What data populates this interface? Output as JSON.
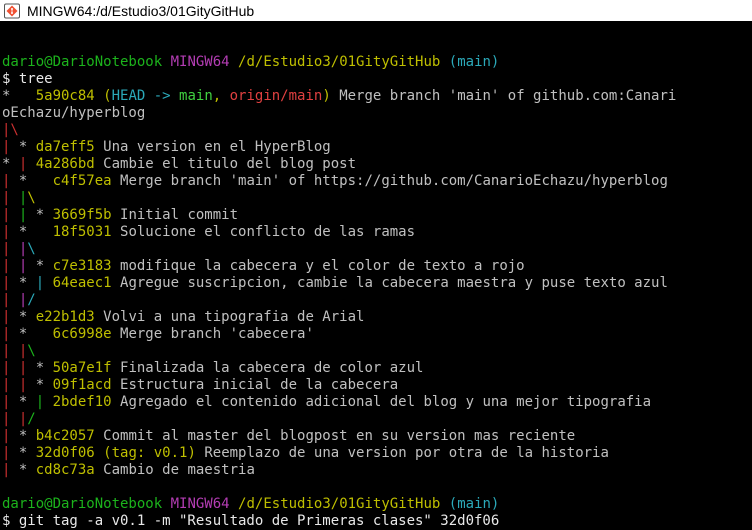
{
  "window": {
    "title": "MINGW64:/d/Estudio3/01GityGitHub"
  },
  "colors": {
    "user": "#1cb31c",
    "shell": "#b43db4",
    "path": "#bfbf00",
    "branch": "#2ba9b9",
    "graph_red": "#cc3030",
    "text": "#c0c0c0",
    "background": "#000000"
  },
  "lines": [
    [],
    [
      {
        "t": "dario@DarioNotebook",
        "c": "green"
      },
      {
        "t": " ",
        "c": "grey"
      },
      {
        "t": "MINGW64",
        "c": "magenta"
      },
      {
        "t": " ",
        "c": "grey"
      },
      {
        "t": "/d/Estudio3/01GityGitHub",
        "c": "yellow"
      },
      {
        "t": " ",
        "c": "grey"
      },
      {
        "t": "(main)",
        "c": "cyan"
      }
    ],
    [
      {
        "t": "$ tree",
        "c": "white"
      }
    ],
    [
      {
        "t": "*   ",
        "c": "grey"
      },
      {
        "t": "5a90c84 ",
        "c": "yellow"
      },
      {
        "t": "(",
        "c": "yellow"
      },
      {
        "t": "HEAD -> ",
        "c": "cyan"
      },
      {
        "t": "main",
        "c": "lime"
      },
      {
        "t": ", ",
        "c": "yellow"
      },
      {
        "t": "origin/main",
        "c": "red-bright"
      },
      {
        "t": ")",
        "c": "yellow"
      },
      {
        "t": " Merge branch 'main' of github.com:Canari",
        "c": "grey"
      }
    ],
    [
      {
        "t": "oEchazu/hyperblog",
        "c": "grey"
      }
    ],
    [
      {
        "t": "|\\",
        "c": "red"
      }
    ],
    [
      {
        "t": "| ",
        "c": "red"
      },
      {
        "t": "* ",
        "c": "grey"
      },
      {
        "t": "da7eff5",
        "c": "yellow"
      },
      {
        "t": " Una version en el HyperBlog",
        "c": "grey"
      }
    ],
    [
      {
        "t": "* ",
        "c": "grey"
      },
      {
        "t": "| ",
        "c": "red"
      },
      {
        "t": "4a286bd",
        "c": "yellow"
      },
      {
        "t": " Cambie el titulo del blog post",
        "c": "grey"
      }
    ],
    [
      {
        "t": "| ",
        "c": "red"
      },
      {
        "t": "*   ",
        "c": "grey"
      },
      {
        "t": "c4f57ea",
        "c": "yellow"
      },
      {
        "t": " Merge branch 'main' of https://github.com/CanarioEchazu/hyperblog",
        "c": "grey"
      }
    ],
    [
      {
        "t": "| ",
        "c": "red"
      },
      {
        "t": "|",
        "c": "green"
      },
      {
        "t": "\\",
        "c": "yellow"
      }
    ],
    [
      {
        "t": "| ",
        "c": "red"
      },
      {
        "t": "| ",
        "c": "green"
      },
      {
        "t": "* ",
        "c": "grey"
      },
      {
        "t": "3669f5b",
        "c": "yellow"
      },
      {
        "t": " Initial commit",
        "c": "grey"
      }
    ],
    [
      {
        "t": "| ",
        "c": "red"
      },
      {
        "t": "*   ",
        "c": "grey"
      },
      {
        "t": "18f5031",
        "c": "yellow"
      },
      {
        "t": " Solucione el conflicto de las ramas",
        "c": "grey"
      }
    ],
    [
      {
        "t": "| ",
        "c": "red"
      },
      {
        "t": "|",
        "c": "magenta"
      },
      {
        "t": "\\",
        "c": "cyan"
      }
    ],
    [
      {
        "t": "| ",
        "c": "red"
      },
      {
        "t": "| ",
        "c": "magenta"
      },
      {
        "t": "* ",
        "c": "grey"
      },
      {
        "t": "c7e3183",
        "c": "yellow"
      },
      {
        "t": " modifique la cabecera y el color de texto a rojo",
        "c": "grey"
      }
    ],
    [
      {
        "t": "| ",
        "c": "red"
      },
      {
        "t": "* ",
        "c": "grey"
      },
      {
        "t": "| ",
        "c": "cyan"
      },
      {
        "t": "64eaec1",
        "c": "yellow"
      },
      {
        "t": " Agregue suscripcion, cambie la cabecera maestra y puse texto azul",
        "c": "grey"
      }
    ],
    [
      {
        "t": "| ",
        "c": "red"
      },
      {
        "t": "|",
        "c": "magenta"
      },
      {
        "t": "/",
        "c": "cyan"
      }
    ],
    [
      {
        "t": "| ",
        "c": "red"
      },
      {
        "t": "* ",
        "c": "grey"
      },
      {
        "t": "e22b1d3",
        "c": "yellow"
      },
      {
        "t": " Volvi a una tipografia de Arial",
        "c": "grey"
      }
    ],
    [
      {
        "t": "| ",
        "c": "red"
      },
      {
        "t": "*   ",
        "c": "grey"
      },
      {
        "t": "6c6998e",
        "c": "yellow"
      },
      {
        "t": " Merge branch 'cabecera'",
        "c": "grey"
      }
    ],
    [
      {
        "t": "| ",
        "c": "red"
      },
      {
        "t": "|",
        "c": "red"
      },
      {
        "t": "\\",
        "c": "green"
      }
    ],
    [
      {
        "t": "| ",
        "c": "red"
      },
      {
        "t": "| ",
        "c": "red"
      },
      {
        "t": "* ",
        "c": "grey"
      },
      {
        "t": "50a7e1f",
        "c": "yellow"
      },
      {
        "t": " Finalizada la cabecera de color azul",
        "c": "grey"
      }
    ],
    [
      {
        "t": "| ",
        "c": "red"
      },
      {
        "t": "| ",
        "c": "red"
      },
      {
        "t": "* ",
        "c": "grey"
      },
      {
        "t": "09f1acd",
        "c": "yellow"
      },
      {
        "t": " Estructura inicial de la cabecera",
        "c": "grey"
      }
    ],
    [
      {
        "t": "| ",
        "c": "red"
      },
      {
        "t": "* ",
        "c": "grey"
      },
      {
        "t": "| ",
        "c": "green"
      },
      {
        "t": "2bdef10",
        "c": "yellow"
      },
      {
        "t": " Agregado el contenido adicional del blog y una mejor tipografia",
        "c": "grey"
      }
    ],
    [
      {
        "t": "| ",
        "c": "red"
      },
      {
        "t": "|",
        "c": "red"
      },
      {
        "t": "/",
        "c": "green"
      }
    ],
    [
      {
        "t": "| ",
        "c": "red"
      },
      {
        "t": "* ",
        "c": "grey"
      },
      {
        "t": "b4c2057",
        "c": "yellow"
      },
      {
        "t": " Commit al master del blogpost en su version mas reciente",
        "c": "grey"
      }
    ],
    [
      {
        "t": "| ",
        "c": "red"
      },
      {
        "t": "* ",
        "c": "grey"
      },
      {
        "t": "32d0f06",
        "c": "yellow"
      },
      {
        "t": " ",
        "c": "grey"
      },
      {
        "t": "(",
        "c": "yellow"
      },
      {
        "t": "tag: v0.1",
        "c": "yellow"
      },
      {
        "t": ")",
        "c": "yellow"
      },
      {
        "t": " Reemplazo de una version por otra de la historia",
        "c": "grey"
      }
    ],
    [
      {
        "t": "| ",
        "c": "red"
      },
      {
        "t": "* ",
        "c": "grey"
      },
      {
        "t": "cd8c73a",
        "c": "yellow"
      },
      {
        "t": " Cambio de maestria",
        "c": "grey"
      }
    ],
    [],
    [
      {
        "t": "dario@DarioNotebook",
        "c": "green"
      },
      {
        "t": " ",
        "c": "grey"
      },
      {
        "t": "MINGW64",
        "c": "magenta"
      },
      {
        "t": " ",
        "c": "grey"
      },
      {
        "t": "/d/Estudio3/01GityGitHub",
        "c": "yellow"
      },
      {
        "t": " ",
        "c": "grey"
      },
      {
        "t": "(main)",
        "c": "cyan"
      }
    ],
    [
      {
        "t": "$ git tag -a v0.1 -m \"Resultado de Primeras clases\" 32d0f06",
        "c": "white"
      }
    ]
  ]
}
